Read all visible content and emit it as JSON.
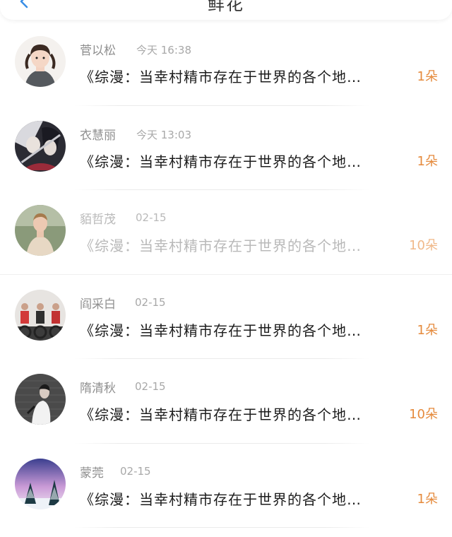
{
  "header": {
    "title": "鲜花"
  },
  "colors": {
    "accent": "#e58a3c",
    "back_icon": "#3a8ee6"
  },
  "messages": [
    {
      "name": "菅以松",
      "time": "今天 16:38",
      "text": "《综漫：当幸村精市存在于世界的各个地…",
      "count": "1朵",
      "read": false,
      "avatar": "girl-portrait"
    },
    {
      "name": "衣慧丽",
      "time": "今天 13:03",
      "text": "《综漫：当幸村精市存在于世界的各个地…",
      "count": "1朵",
      "read": false,
      "avatar": "anime-art"
    },
    {
      "name": "貊哲茂",
      "time": "02-15",
      "text": "《综漫：当幸村精市存在于世界的各个地…",
      "count": "10朵",
      "read": true,
      "avatar": "man-outdoor"
    },
    {
      "name": "阎采白",
      "time": "02-15",
      "text": "《综漫：当幸村精市存在于世界的各个地…",
      "count": "1朵",
      "read": false,
      "avatar": "cycling-class"
    },
    {
      "name": "隋清秋",
      "time": "02-15",
      "text": "《综漫：当幸村精市存在于世界的各个地…",
      "count": "10朵",
      "read": false,
      "avatar": "person-brick-wall"
    },
    {
      "name": "蒙莞",
      "time": "02-15",
      "text": "《综漫：当幸村精市存在于世界的各个地…",
      "count": "1朵",
      "read": false,
      "avatar": "winter-trees"
    }
  ]
}
